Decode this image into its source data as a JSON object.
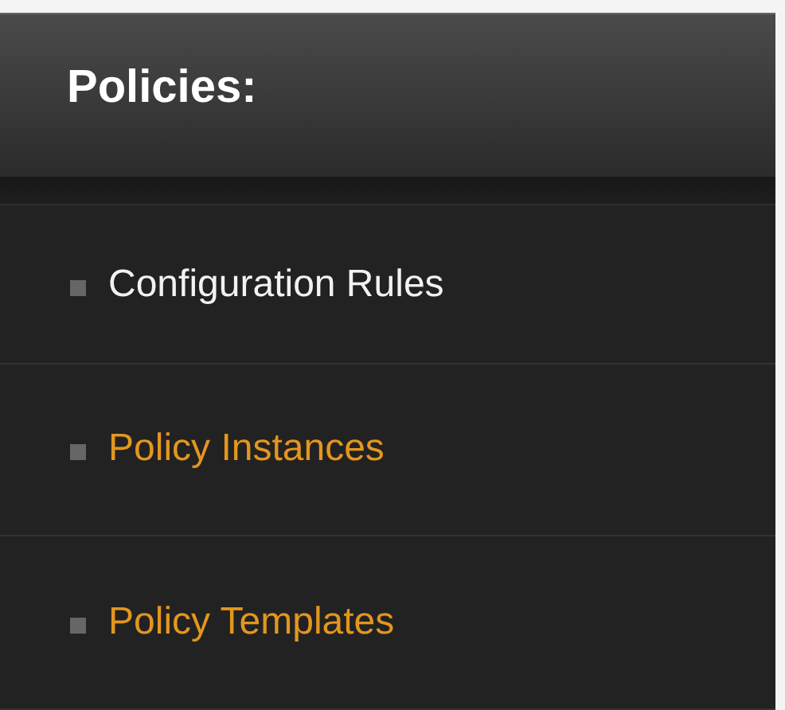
{
  "panel": {
    "title": "Policies:"
  },
  "items": [
    {
      "label": "Configuration Rules",
      "selected": true
    },
    {
      "label": "Policy Instances",
      "selected": false
    },
    {
      "label": "Policy Templates",
      "selected": false
    }
  ]
}
